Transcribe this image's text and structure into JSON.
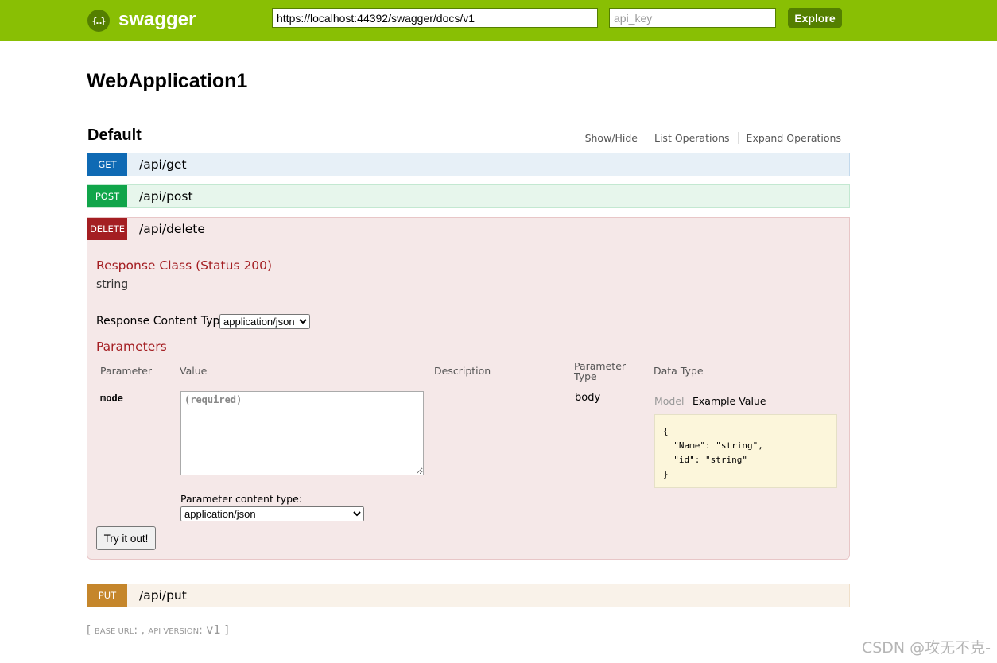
{
  "header": {
    "logo_text": "swagger",
    "logo_icon_glyph": "{…}",
    "url_value": "https://localhost:44392/swagger/docs/v1",
    "api_key_placeholder": "api_key",
    "explore_label": "Explore"
  },
  "page_title": "WebApplication1",
  "section": {
    "title": "Default",
    "links": [
      "Show/Hide",
      "List Operations",
      "Expand Operations"
    ]
  },
  "operations": {
    "get": {
      "verb": "GET",
      "path": "/api/get"
    },
    "post": {
      "verb": "POST",
      "path": "/api/post"
    },
    "delete": {
      "verb": "DELETE",
      "path": "/api/delete"
    },
    "put": {
      "verb": "PUT",
      "path": "/api/put"
    }
  },
  "delete_detail": {
    "response_class_title": "Response Class (Status 200)",
    "response_class_value": "string",
    "response_content_type_label": "Response Content Type",
    "response_content_type_value": "application/json",
    "parameters_title": "Parameters",
    "table_headers": {
      "parameter": "Parameter",
      "value": "Value",
      "description": "Description",
      "parameter_type_line1": "Parameter",
      "parameter_type_line2": "Type",
      "data_type": "Data Type"
    },
    "param": {
      "name": "mode",
      "placeholder": "(required)",
      "type": "body",
      "model_tab": "Model",
      "example_tab": "Example Value",
      "example_value": "{\n  \"Name\": \"string\",\n  \"id\": \"string\"\n}",
      "content_type_label": "Parameter content type:",
      "content_type_value": "application/json"
    },
    "try_button": "Try it out!"
  },
  "footer": {
    "bracket_open": "[ ",
    "base_url_label": "base url",
    "base_url_value": ": , ",
    "api_version_label": "api version",
    "api_version_sep": ": ",
    "api_version_value": "v1",
    "bracket_close": " ]"
  },
  "watermark": "CSDN @攻无不克-",
  "colors": {
    "header_bg": "#89bf04",
    "get": "#0f6ab4",
    "post": "#10a54a",
    "delete": "#a41e22",
    "put": "#c5862b"
  }
}
